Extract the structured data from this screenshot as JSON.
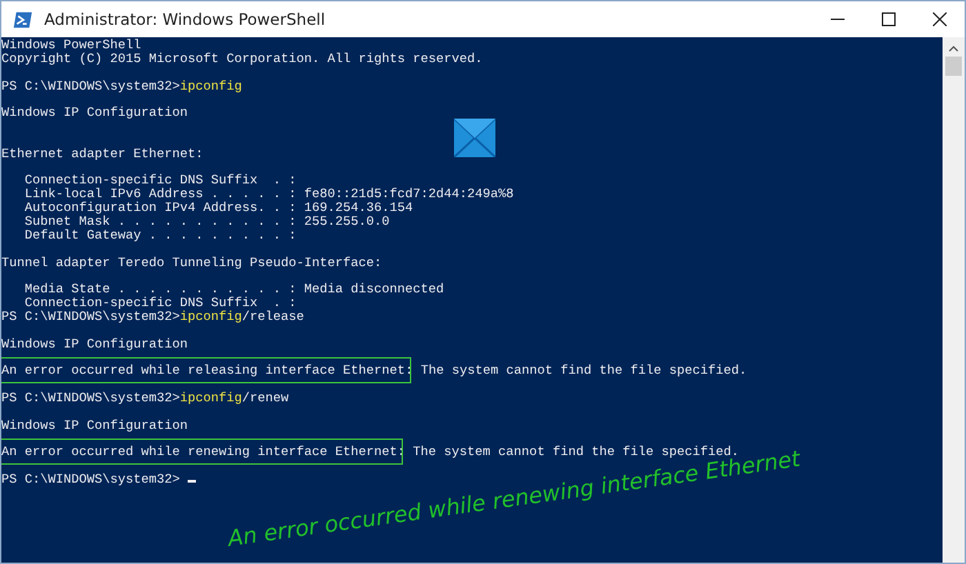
{
  "window": {
    "title": "Administrator: Windows PowerShell"
  },
  "console": {
    "lines": [
      {
        "kind": "output",
        "text": "Windows PowerShell"
      },
      {
        "kind": "output",
        "text": "Copyright (C) 2015 Microsoft Corporation. All rights reserved."
      },
      {
        "kind": "blank"
      },
      {
        "kind": "prompt",
        "prompt": "PS C:\\WINDOWS\\system32>",
        "command": "ipconfig"
      },
      {
        "kind": "blank"
      },
      {
        "kind": "output",
        "text": "Windows IP Configuration"
      },
      {
        "kind": "blank"
      },
      {
        "kind": "blank"
      },
      {
        "kind": "output",
        "text": "Ethernet adapter Ethernet:"
      },
      {
        "kind": "blank"
      },
      {
        "kind": "output",
        "text": "   Connection-specific DNS Suffix  . :"
      },
      {
        "kind": "output",
        "text": "   Link-local IPv6 Address . . . . . : fe80::21d5:fcd7:2d44:249a%8"
      },
      {
        "kind": "output",
        "text": "   Autoconfiguration IPv4 Address. . : 169.254.36.154"
      },
      {
        "kind": "output",
        "text": "   Subnet Mask . . . . . . . . . . . : 255.255.0.0"
      },
      {
        "kind": "output",
        "text": "   Default Gateway . . . . . . . . . :"
      },
      {
        "kind": "blank"
      },
      {
        "kind": "output",
        "text": "Tunnel adapter Teredo Tunneling Pseudo-Interface:"
      },
      {
        "kind": "blank"
      },
      {
        "kind": "output",
        "text": "   Media State . . . . . . . . . . . : Media disconnected"
      },
      {
        "kind": "output",
        "text": "   Connection-specific DNS Suffix  . :"
      },
      {
        "kind": "prompt",
        "prompt": "PS C:\\WINDOWS\\system32>",
        "command": "ipconfig",
        "args": "/release"
      },
      {
        "kind": "blank"
      },
      {
        "kind": "output",
        "text": "Windows IP Configuration"
      },
      {
        "kind": "blank"
      },
      {
        "kind": "error",
        "highlighted": true,
        "text": "An error occurred while releasing interface Ethernet",
        "rest": ": The system cannot find the file specified."
      },
      {
        "kind": "blank"
      },
      {
        "kind": "prompt",
        "prompt": "PS C:\\WINDOWS\\system32>",
        "command": "ipconfig",
        "args": "/renew"
      },
      {
        "kind": "blank"
      },
      {
        "kind": "output",
        "text": "Windows IP Configuration"
      },
      {
        "kind": "blank"
      },
      {
        "kind": "error",
        "highlighted": true,
        "text": "An error occurred while renewing interface Ethernet",
        "rest": ": The system cannot find the file specified."
      },
      {
        "kind": "blank"
      },
      {
        "kind": "prompt",
        "prompt": "PS C:\\WINDOWS\\system32>",
        "cursor": true
      }
    ]
  },
  "annotation": {
    "text": "An error occurred while renewing interface Ethernet"
  }
}
